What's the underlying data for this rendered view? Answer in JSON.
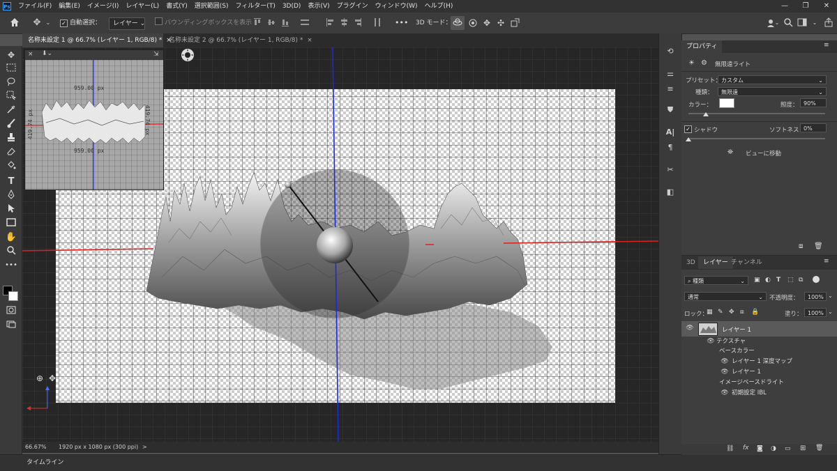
{
  "menu": {
    "logo": "Ps",
    "items": [
      "ファイル(F)",
      "編集(E)",
      "イメージ(I)",
      "レイヤー(L)",
      "書式(Y)",
      "選択範囲(S)",
      "フィルター(T)",
      "3D(D)",
      "表示(V)",
      "プラグイン",
      "ウィンドウ(W)",
      "ヘルプ(H)"
    ],
    "minimize": "—",
    "maximize": "❐",
    "close": "✕"
  },
  "options": {
    "home_icon": "home-icon",
    "auto_select_label": "自動選択：",
    "auto_select_value": "レイヤー",
    "bounding_box_label": "バウンディングボックスを表示",
    "mode_3d_label": "3D モード：",
    "more": "•••"
  },
  "tabs": [
    {
      "label": "名称未設定 1 @ 66.7% (レイヤー 1, RGB/8) *",
      "close": "×"
    },
    {
      "label": "名称未設定 2 @ 66.7% (レイヤー 1, RGB/8) *",
      "close": "×"
    }
  ],
  "thumbnail": {
    "top_label": "959.00  px",
    "bottom_label": "959.00  px",
    "left_label": "419.74 px",
    "right_label": "419.74 px"
  },
  "status": {
    "zoom": "66.67%",
    "doc_info": "1920 px x 1080 px (300 ppi)",
    "arrow": ">"
  },
  "timeline": {
    "label": "タイムライン"
  },
  "properties": {
    "tab": "プロパティ",
    "light_type": "無限遠ライト",
    "preset_label": "プリセット：",
    "preset_value": "カスタム",
    "kind_label": "種類：",
    "kind_value": "無限遠",
    "color_label": "カラー：",
    "intensity_label": "照度：",
    "intensity_value": "90%",
    "shadow_label": "シャドウ",
    "softness_label": "ソフトネス：",
    "softness_value": "0%",
    "move_to_view": "ビューに移動",
    "light_color": "#ffffff"
  },
  "layers_panel": {
    "tabs": [
      "3D",
      "レイヤー",
      "チャンネル"
    ],
    "filter_value": "種類",
    "blend_mode": "通常",
    "opacity_label": "不透明度：",
    "opacity_value": "100%",
    "lock_label": "ロック：",
    "fill_label": "塗り：",
    "fill_value": "100%",
    "rows": {
      "layer1": "レイヤー 1",
      "texture": "テクスチャ",
      "base_color": "ベースカラー",
      "depth_map": "レイヤー 1 深度マップ",
      "layer1_sub": "レイヤー 1",
      "ibl": "イメージベースドライト",
      "ibl_default": "初期設定 IBL"
    }
  },
  "colors": {
    "accent_blue": "#31a8ff",
    "axis_red": "#e02020",
    "axis_blue": "#1a2bdc"
  }
}
